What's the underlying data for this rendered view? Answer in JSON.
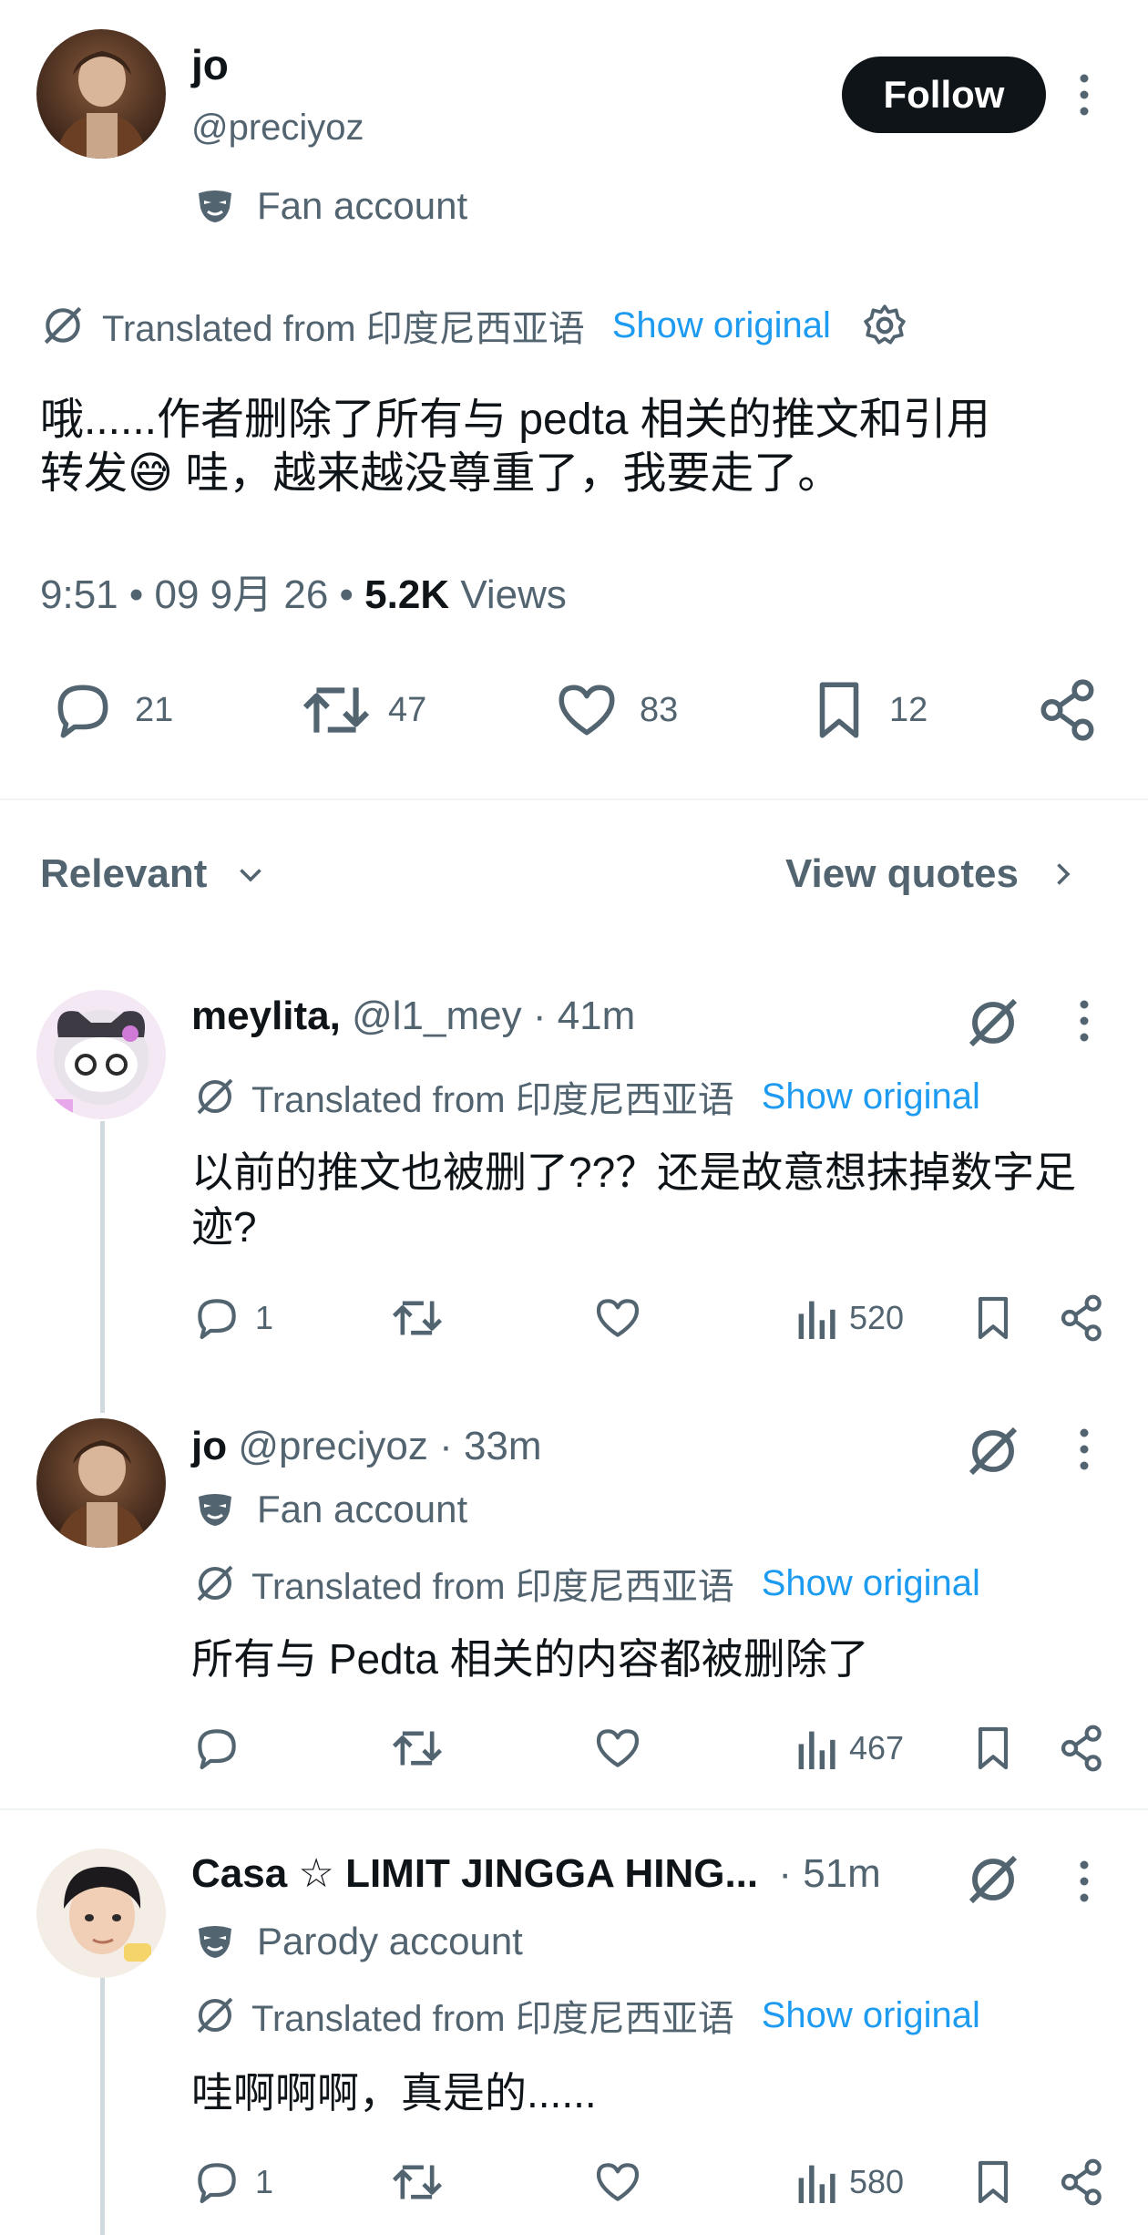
{
  "post": {
    "author_name": "jo",
    "author_handle": "@preciyoz",
    "badge_text": "Fan account",
    "follow_label": "Follow",
    "translated_text": "Translated from 印度尼西亚语",
    "show_original": "Show original",
    "body_line1": "哦......作者删除了所有与 pedta 相关的推文和引用",
    "body_line2_pre": "转发",
    "body_line2_post": " 哇，越来越没尊重了，我要走了。",
    "emoji": "😅",
    "time": "9:51 • 09 9月 26 • ",
    "views_count": "5.2K",
    "views_label": " Views",
    "stats": {
      "replies": "21",
      "reposts": "47",
      "likes": "83",
      "bookmarks": "12"
    }
  },
  "sort": {
    "label": "Relevant",
    "view_quotes": "View quotes"
  },
  "replies": [
    {
      "name": "meylita,",
      "meta": " @l1_mey · 41m",
      "translated_text": "Translated from 印度尼西亚语",
      "show_original": "Show original",
      "text_line1": "以前的推文也被删了??？还是故意想抹掉数字足",
      "text_line2": "迹?",
      "replies": "1",
      "views": "520"
    },
    {
      "name": "jo",
      "meta": " @preciyoz · 33m",
      "badge_text": "Fan account",
      "translated_text": "Translated from 印度尼西亚语",
      "show_original": "Show original",
      "text_line1": "所有与 Pedta 相关的内容都被删除了",
      "views": "467"
    },
    {
      "name": "Casa ☆ LIMIT JINGGA HING...",
      "meta": " · 51m",
      "badge_text": "Parody account",
      "translated_text": "Translated from 印度尼西亚语",
      "show_original": "Show original",
      "text_line1": "哇啊啊啊，真是的......",
      "replies": "1",
      "views": "580"
    }
  ],
  "colors": {
    "accent": "#1d9bf0",
    "text": "#0f1419",
    "secondary": "#536471",
    "divider": "#eff3f4"
  }
}
